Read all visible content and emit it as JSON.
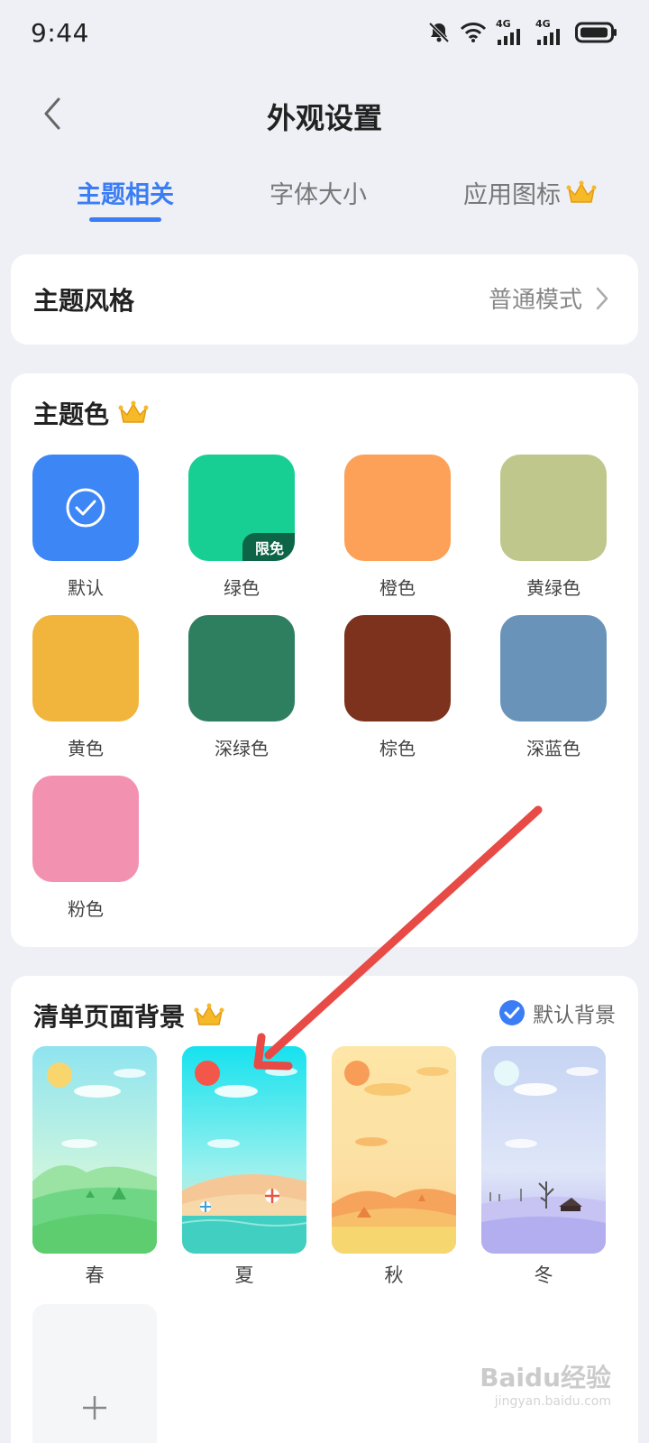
{
  "status_bar": {
    "time": "9:44",
    "net1": "4G",
    "net2": "4G"
  },
  "header": {
    "title": "外观设置",
    "back_icon": "chevron-left-icon"
  },
  "tabs": [
    {
      "label": "主题相关",
      "active": true
    },
    {
      "label": "字体大小",
      "active": false
    },
    {
      "label": "应用图标",
      "active": false,
      "icon": "crown-icon"
    }
  ],
  "theme_style": {
    "label": "主题风格",
    "value": "普通模式"
  },
  "theme_color": {
    "title": "主题色",
    "free_badge": "限免",
    "items": [
      {
        "label": "默认",
        "color": "#3d86f5",
        "selected": true
      },
      {
        "label": "绿色",
        "color": "#17cf93"
      },
      {
        "label": "橙色",
        "color": "#fda158"
      },
      {
        "label": "黄绿色",
        "color": "#c0c78c"
      },
      {
        "label": "黄色",
        "color": "#f1b43c"
      },
      {
        "label": "深绿色",
        "color": "#2d7f60"
      },
      {
        "label": "棕色",
        "color": "#7c321c"
      },
      {
        "label": "深蓝色",
        "color": "#6a93b9"
      },
      {
        "label": "粉色",
        "color": "#f391b0"
      }
    ]
  },
  "list_background": {
    "title": "清单页面背景",
    "default_label": "默认背景",
    "items": [
      {
        "label": "春"
      },
      {
        "label": "夏"
      },
      {
        "label": "秋"
      },
      {
        "label": "冬"
      }
    ],
    "add_icon": "plus-icon"
  },
  "watermark": {
    "text": "Baidu经验",
    "url": "jingyan.baidu.com"
  }
}
